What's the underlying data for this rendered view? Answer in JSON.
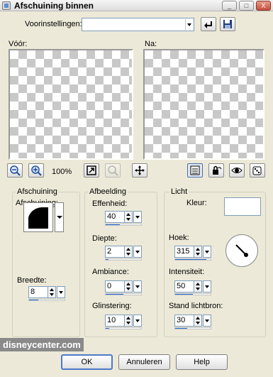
{
  "window": {
    "title": "Afschuining binnen",
    "controls": {
      "minimize": "_",
      "maximize": "□",
      "close": "X"
    }
  },
  "presets": {
    "label": "Voorinstellingen:",
    "value": ""
  },
  "previews": {
    "before_label": "Vóór:",
    "after_label": "Na:",
    "zoom_percent": "100%"
  },
  "bevel_group": {
    "title": "Afschuining",
    "bevel_label": "Afschuining:",
    "width_label": "Breedte:",
    "width_value": "8",
    "width_level": 0.25
  },
  "image_group": {
    "title": "Afbeelding",
    "smoothness": {
      "label": "Effenheid:",
      "value": "40",
      "level": 0.4
    },
    "depth": {
      "label": "Diepte:",
      "value": "2",
      "level": 0.08
    },
    "ambience": {
      "label": "Ambiance:",
      "value": "0",
      "level": 0.5
    },
    "shininess": {
      "label": "Glinstering:",
      "value": "10",
      "level": 0.1
    }
  },
  "light_group": {
    "title": "Licht",
    "color_label": "Kleur:",
    "color": "#ffffff",
    "angle": {
      "label": "Hoek:",
      "value": "315",
      "level": 0.875
    },
    "intensity": {
      "label": "Intensiteit:",
      "value": "50",
      "level": 0.5
    },
    "elevation": {
      "label": "Stand lichtbron:",
      "value": "30",
      "level": 0.33
    }
  },
  "watermark": "disneycenter.com",
  "buttons": {
    "ok": "OK",
    "cancel": "Annuleren",
    "help": "Help"
  },
  "colors": {
    "accent": "#2f6fd6",
    "dialog_bg": "#ece9d8"
  }
}
